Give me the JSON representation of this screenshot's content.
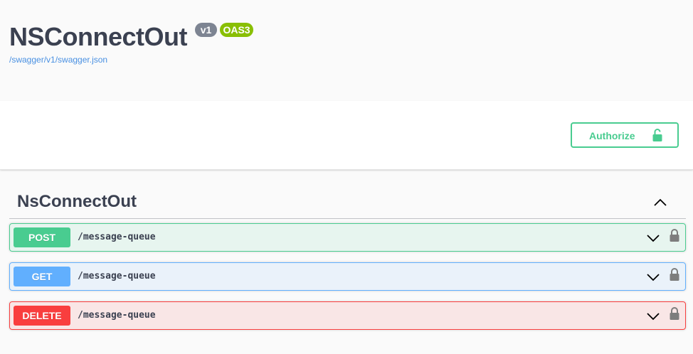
{
  "info": {
    "title": "NSConnectOut",
    "version_badge": "v1",
    "oas_badge": "OAS3",
    "spec_link": "/swagger/v1/swagger.json"
  },
  "authorize": {
    "label": "Authorize",
    "icon": "unlocked-icon"
  },
  "tag": {
    "name": "NsConnectOut",
    "toggle_icon": "chevron-up-icon"
  },
  "operations": [
    {
      "method": "POST",
      "path": "/message-queue",
      "color": "#49cc90"
    },
    {
      "method": "GET",
      "path": "/message-queue",
      "color": "#61affe"
    },
    {
      "method": "DELETE",
      "path": "/message-queue",
      "color": "#f93e3e"
    }
  ],
  "colors": {
    "post": "#49cc90",
    "get": "#61affe",
    "delete": "#f93e3e",
    "title": "#3b4151",
    "link": "#4990e2"
  }
}
